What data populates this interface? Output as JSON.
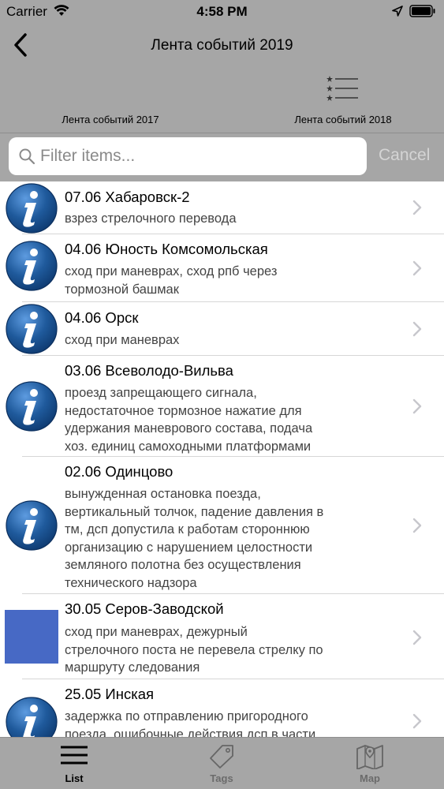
{
  "status": {
    "carrier": "Carrier",
    "time": "4:58 PM"
  },
  "nav": {
    "title": "Лента событий 2019",
    "left_link": "Лента событий 2017",
    "right_link": "Лента событий 2018"
  },
  "search": {
    "placeholder": "Filter items...",
    "value": "",
    "cancel_label": "Cancel"
  },
  "events": [
    {
      "title": "07.06 Хабаровск-2",
      "desc": [
        "взрез стрелочного перевода"
      ],
      "icon": "info-icon"
    },
    {
      "title": "04.06 Юность Комсомольская",
      "desc": [
        "сход при маневрах, сход рпб через",
        "тормозной башмак"
      ],
      "icon": "info-icon"
    },
    {
      "title": "04.06 Орск",
      "desc": [
        "сход при маневрах"
      ],
      "icon": "info-icon"
    },
    {
      "title": "03.06 Всеволодо-Вильва",
      "desc": [
        "проезд запрещающего сигнала,",
        "недостаточное тормозное нажатие для",
        "удержания маневрового состава, подача",
        "хоз. единиц самоходными платформами"
      ],
      "icon": "info-icon"
    },
    {
      "title": "02.06 Одинцово",
      "desc": [
        "вынужденная остановка поезда,",
        "вертикальный толчок, падение давления в",
        "тм, дсп допустила к работам стороннюю",
        "организацию с нарушением целостности",
        "земляного полотна без осуществления",
        "технического надзора"
      ],
      "icon": "info-icon"
    },
    {
      "title": "30.05 Серов-Заводской",
      "desc": [
        "сход при маневрах, дежурный",
        "стрелочного поста не перевела стрелку по",
        "маршруту следования"
      ],
      "icon": "placeholder-image"
    },
    {
      "title": "25.05 Инская",
      "desc": [
        "задержка по отправлению пригородного",
        "поезда, ошибочные действия дсп в части"
      ],
      "icon": "info-icon"
    }
  ],
  "tabs": [
    {
      "label": "List",
      "icon": "hamburger-icon",
      "active": true
    },
    {
      "label": "Tags",
      "icon": "tag-icon",
      "active": false
    },
    {
      "label": "Map",
      "icon": "map-icon",
      "active": false
    }
  ],
  "colors": {
    "header_bg": "#a6a6a6",
    "info_blue": "#1f5a9c",
    "placeholder_blue": "#4769c5"
  }
}
